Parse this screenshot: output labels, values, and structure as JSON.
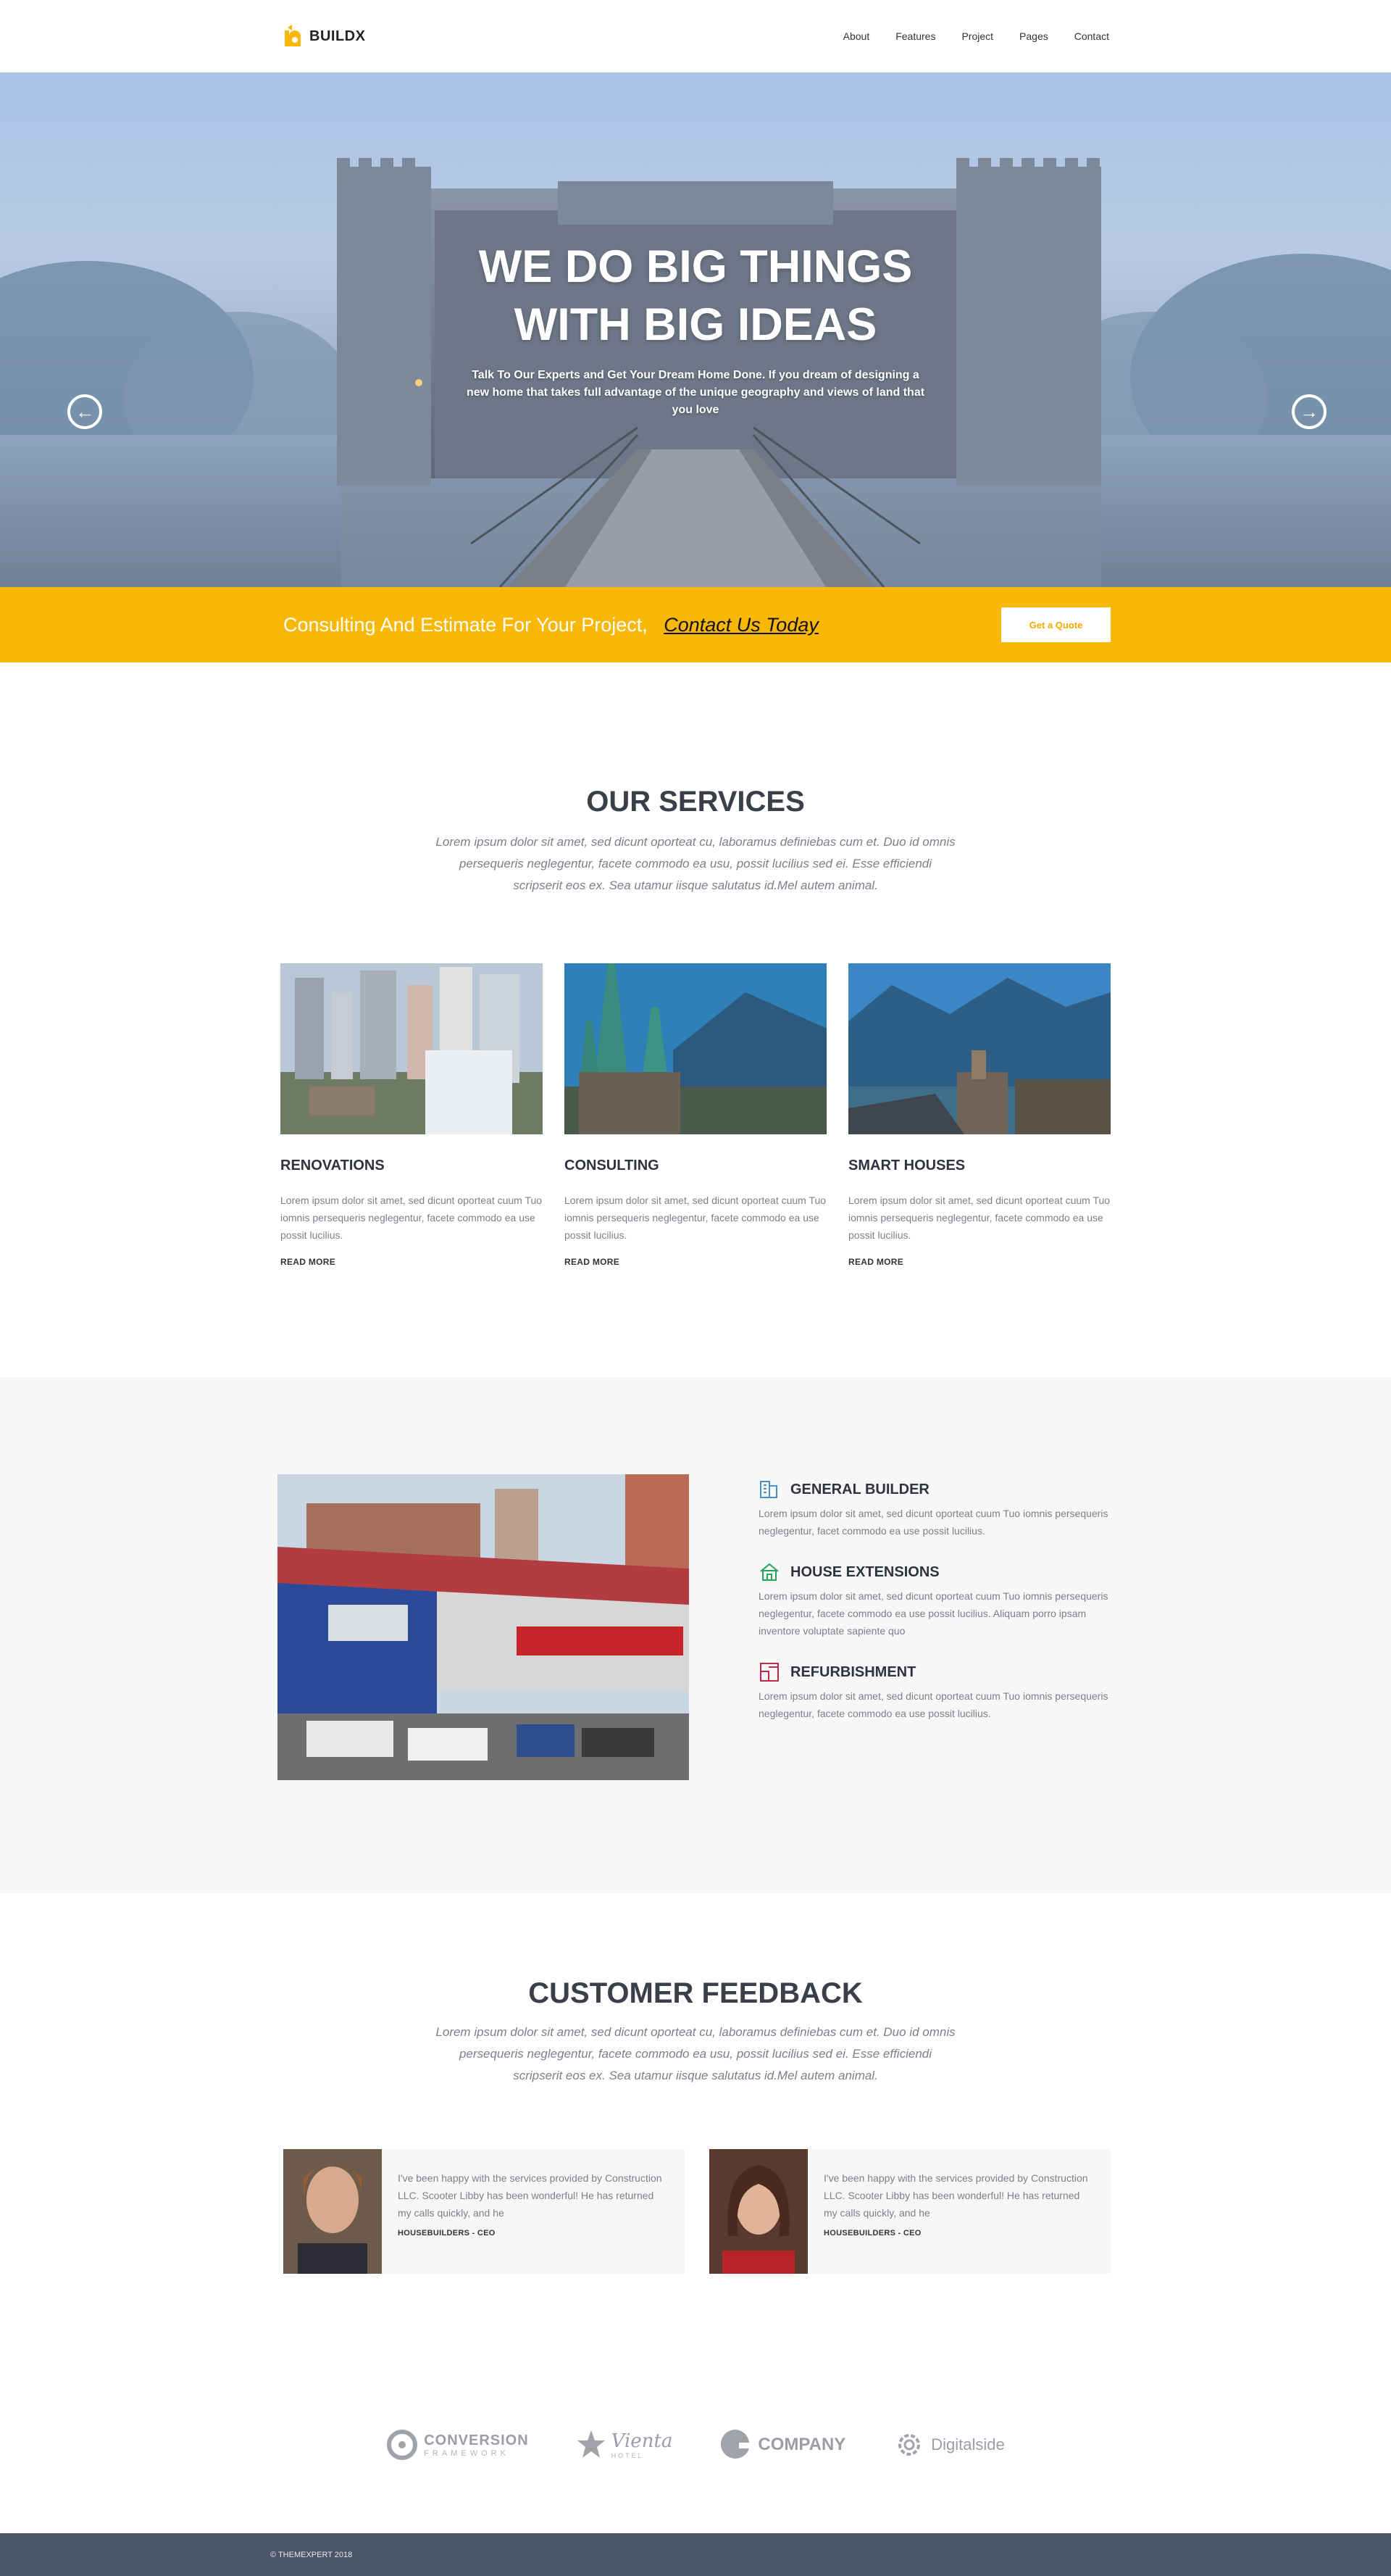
{
  "brand": {
    "name": "BUILDX",
    "accent": "#f9b707"
  },
  "nav": {
    "items": [
      "About",
      "Features",
      "Project",
      "Pages",
      "Contact"
    ]
  },
  "hero": {
    "title_line1": "WE DO BIG THINGS",
    "title_line2": "WITH BIG IDEAS",
    "subtitle": "Talk To Our Experts and Get Your Dream Home Done. If you dream of designing a new home that takes full advantage  of the unique geography and views of land that you love",
    "prev_icon": "arrow-left-circle-icon",
    "next_icon": "arrow-right-circle-icon",
    "slides_total": 3,
    "active_slide": 1
  },
  "cta": {
    "text": "Consulting And Estimate For Your Project,",
    "link": "Contact Us Today",
    "button": "Get a Quote"
  },
  "services": {
    "title": "OUR SERVICES",
    "intro": "Lorem ipsum dolor sit amet, sed dicunt oporteat cu, laboramus definiebas cum et. Duo id omnis persequeris neglegentur, facete commodo ea usu, possit lucilius sed ei. Esse efficiendi scripserit eos ex. Sea utamur iisque salutatus id.Mel autem animal.",
    "items": [
      {
        "title": "RENOVATIONS",
        "text": "Lorem ipsum dolor sit amet, sed dicunt oporteat cuum Tuo iomnis persequeris neglegentur, facete commodo ea use possit lucilius.",
        "more": "READ MORE"
      },
      {
        "title": "CONSULTING",
        "text": "Lorem ipsum dolor sit amet, sed dicunt oporteat cuum Tuo iomnis persequeris neglegentur, facete commodo ea use possit lucilius.",
        "more": "READ MORE"
      },
      {
        "title": "SMART HOUSES",
        "text": "Lorem ipsum dolor sit amet, sed dicunt oporteat cuum Tuo iomnis persequeris neglegentur, facete commodo ea use possit lucilius.",
        "more": "READ MORE"
      }
    ]
  },
  "features": {
    "items": [
      {
        "icon": "building-icon",
        "title": "GENERAL BUILDER",
        "text": "Lorem ipsum dolor sit amet, sed dicunt oporteat cuum Tuo iomnis persequeris neglegentur, facet  commodo ea use possit lucilius."
      },
      {
        "icon": "house-icon",
        "title": "HOUSE EXTENSIONS",
        "text": "Lorem ipsum dolor sit amet, sed dicunt oporteat cuum Tuo iomnis persequeris neglegentur, facete commodo ea use possit lucilius. Aliquam porro ipsam inventore voluptate sapiente quo"
      },
      {
        "icon": "floorplan-icon",
        "title": "REFURBISHMENT",
        "text": "Lorem ipsum dolor sit amet, sed dicunt oporteat cuum Tuo iomnis persequeris neglegentur, facete commodo ea use possit lucilius."
      }
    ]
  },
  "feedback": {
    "title": "CUSTOMER FEEDBACK",
    "intro": "Lorem ipsum dolor sit amet, sed dicunt oporteat cu, laboramus definiebas cum et. Duo id omnis persequeris neglegentur, facete commodo ea usu, possit lucilius sed ei. Esse efficiendi scripserit eos ex. Sea utamur iisque salutatus id.Mel autem animal.",
    "items": [
      {
        "quote": "I've been happy with the services provided by Construction LLC. Scooter Libby has been wonderful! He has returned my calls quickly, and he",
        "author": "HOUSEBUILDERS - CEO"
      },
      {
        "quote": "I've been happy with the services provided by Construction LLC. Scooter Libby has been wonderful! He has returned my calls quickly, and he",
        "author": "HOUSEBUILDERS - CEO"
      }
    ]
  },
  "clients": {
    "items": [
      {
        "name": "CONVERSION",
        "sub": "FRAMEWORK"
      },
      {
        "name": "Vienta",
        "sub": "HOTEL"
      },
      {
        "name": "COMPANY",
        "sub": ""
      },
      {
        "name": "Digitalside",
        "sub": ""
      }
    ]
  },
  "footer": {
    "copyright": "© THEMEXPERT 2018"
  }
}
